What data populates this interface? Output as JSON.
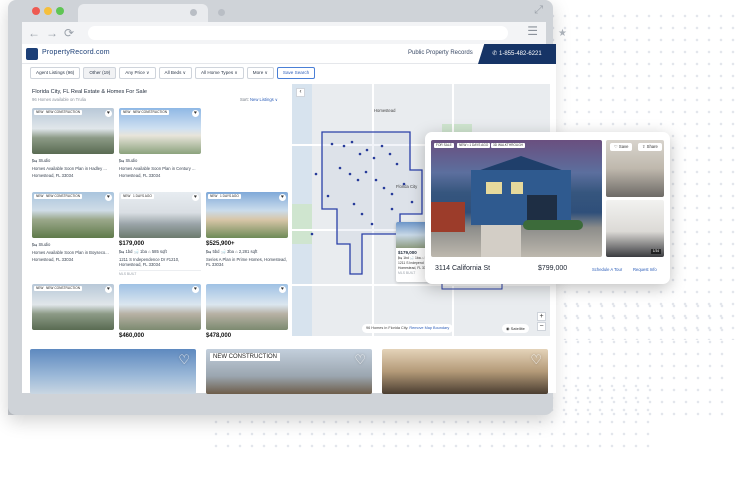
{
  "browser": {
    "nav": {
      "back": "←",
      "forward": "→",
      "reload": "⟳"
    }
  },
  "header": {
    "logo": "PropertyRecord.com",
    "link": "Public Property Records",
    "phone": "1-855-482-6221"
  },
  "filters": [
    {
      "label": "Agent Listings (96)",
      "style": "plain"
    },
    {
      "label": "Other (19)",
      "style": "grey"
    },
    {
      "label": "Any Price ∨",
      "style": "plain"
    },
    {
      "label": "All Beds ∨",
      "style": "plain"
    },
    {
      "label": "All Home Types ∨",
      "style": "plain"
    },
    {
      "label": "More ∨",
      "style": "plain"
    },
    {
      "label": "Save Search",
      "style": "save"
    }
  ],
  "listing": {
    "title": "Florida City, FL Real Estate & Homes For Sale",
    "subtitle": "96 Homes available on Trulia",
    "sort_label": "Sort:",
    "sort_value": "New Listings ∨"
  },
  "cards": [
    {
      "tag": "NEW",
      "tag2": "NEW CONSTRUCTION",
      "line1": "🛏 Studio",
      "price": "",
      "line2": "Homes Available Soon Plan in Hadley ...",
      "line3": "Homestead, FL 33034",
      "mls": ""
    },
    {
      "tag": "NEW",
      "tag2": "NEW CONSTRUCTION",
      "line1": "🛏 Studio",
      "price": "",
      "line2": "Homes Available Soon Plan in Century ...",
      "line3": "Homestead, FL 33034",
      "mls": ""
    },
    {
      "tag": "NEW",
      "tag2": "NEW CONSTRUCTION",
      "line1": "🛏 Studio",
      "price": "",
      "line2": "Homes Available Soon Plan in Boyseco...",
      "line3": "Homestead, FL 33034",
      "mls": ""
    },
    {
      "tag": "NEW",
      "tag2": "1 DAYS AGO",
      "line1": "",
      "price": "$179,000",
      "line2": "🛏 1bd 🛁 1ba ⌂ 585 sqft",
      "line3": "1211 S Independence Dr #1210, Homestead, FL 33034",
      "mls": "MLS BUILT"
    },
    {
      "tag": "NEW",
      "tag2": "1 DAYS AGO",
      "line1": "",
      "price": "$525,900+",
      "line2": "🛏 5bd 🛁 3ba ⌂ 2,281 sqft",
      "line3": "Series A Plan in Prime Homes, Homestead, FL 33034",
      "mls": ""
    },
    {
      "tag": "NEW",
      "tag2": "NEW CONSTRUCTION",
      "line1": "",
      "price": "",
      "line2": "",
      "line3": "",
      "mls": ""
    },
    {
      "tag": "",
      "tag2": "",
      "line1": "",
      "price": "$460,000",
      "line2": "",
      "line3": "",
      "mls": ""
    },
    {
      "tag": "",
      "tag2": "",
      "line1": "",
      "price": "$478,000",
      "line2": "",
      "line3": "",
      "mls": ""
    }
  ],
  "map": {
    "place_top": "Homestead",
    "place_city": "Florida City",
    "pill_count": "96 Homes in Florida City.",
    "pill_link": "Remove Map Boundary",
    "satellite": "Satellite",
    "zoom_in": "+",
    "zoom_out": "−",
    "collapse": "‹",
    "popup": {
      "price": "$179,000",
      "specs": "🛏 1bd 🛁 1ba ⌂ 585",
      "addr1": "1211 S Independ",
      "addr2": "Homestead, FL 33",
      "mls": "MLS BUILT"
    }
  },
  "bottom": {
    "tag": "NEW CONSTRUCTION"
  },
  "detail": {
    "tags": [
      "FOR SALE",
      "NEW • 1 DAYS AGO",
      "3D WALKTHROUGH"
    ],
    "save": "♡ Save",
    "share": "⇧ Share",
    "counter": "1/34",
    "address": "3114 California St",
    "price": "$799,000",
    "schedule": "Schedule A Tour",
    "request": "Request Info"
  }
}
